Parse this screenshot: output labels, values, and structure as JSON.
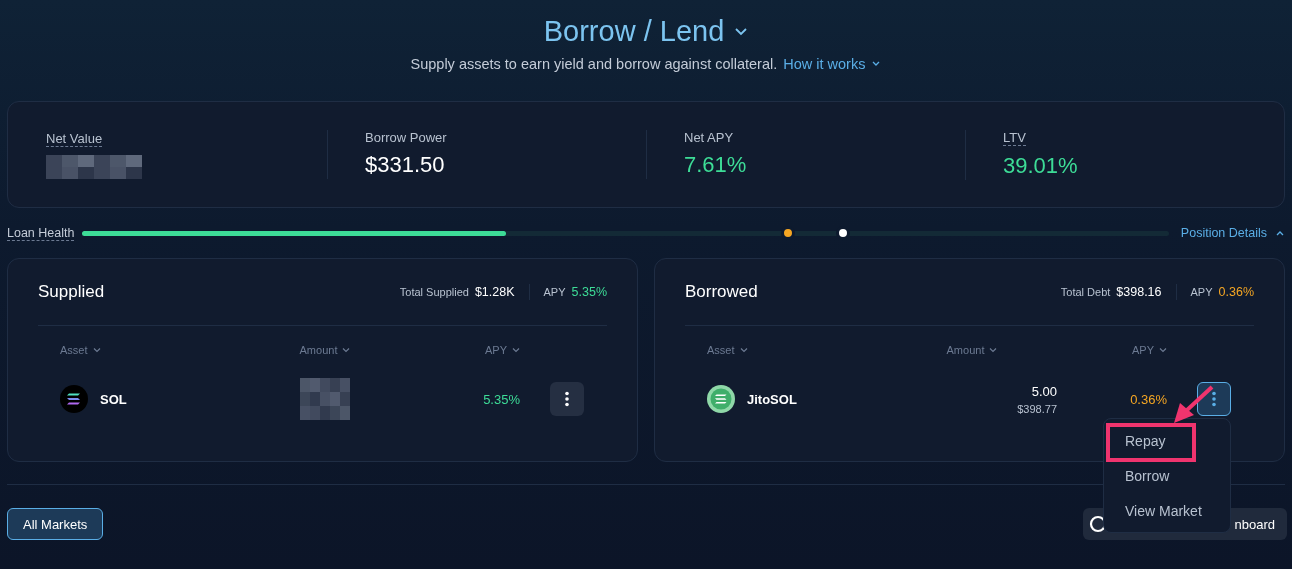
{
  "header": {
    "title": "Borrow / Lend",
    "subtitle": "Supply assets to earn yield and borrow against collateral.",
    "link": "How it works"
  },
  "stats": [
    {
      "label": "Net Value",
      "kind": "redacted",
      "dotted": true
    },
    {
      "label": "Borrow Power",
      "kind": "value",
      "value": "$331.50",
      "color": "#ffffff",
      "dotted": false
    },
    {
      "label": "Net APY",
      "kind": "value",
      "value": "7.61%",
      "color": "#3ddc97",
      "dotted": false
    },
    {
      "label": "LTV",
      "kind": "value",
      "value": "39.01%",
      "color": "#3ddc97",
      "dotted": true
    }
  ],
  "loan_health": {
    "label": "Loan Health",
    "level": 0.39,
    "markers": [
      {
        "color": "#f5a623",
        "level": 0.648
      },
      {
        "color": "#ffffff",
        "level": 0.698
      }
    ],
    "details_link": "Position Details",
    "expanded": true
  },
  "panels": [
    {
      "title": "Supplied",
      "total_label": "Total Supplied",
      "total": "$1.28K",
      "apy_label": "APY",
      "apy": "5.35%",
      "color": "#3ddc97",
      "columns": [
        "Asset",
        "Amount",
        "APY"
      ],
      "rows": [
        {
          "asset": "SOL",
          "kind": "redacted",
          "apy": "5.35%",
          "menu_open": false
        }
      ]
    },
    {
      "title": "Borrowed",
      "total_label": "Total Debt",
      "total": "$398.16",
      "apy_label": "APY",
      "apy": "0.36%",
      "color": "#f5a623",
      "columns": [
        "Asset",
        "Amount",
        "APY"
      ],
      "rows": [
        {
          "asset": "JitoSOL",
          "kind": "value",
          "amount": "5.00",
          "amount_usd": "$398.77",
          "apy": "0.36%",
          "menu_open": true
        }
      ]
    }
  ],
  "menu": [
    {
      "label": "Repay",
      "highlighted": true
    },
    {
      "label": "Borrow",
      "highlighted": false
    },
    {
      "label": "View Market",
      "highlighted": false
    }
  ],
  "footer": {
    "left_button": "All Markets",
    "right_button": "nboard"
  }
}
